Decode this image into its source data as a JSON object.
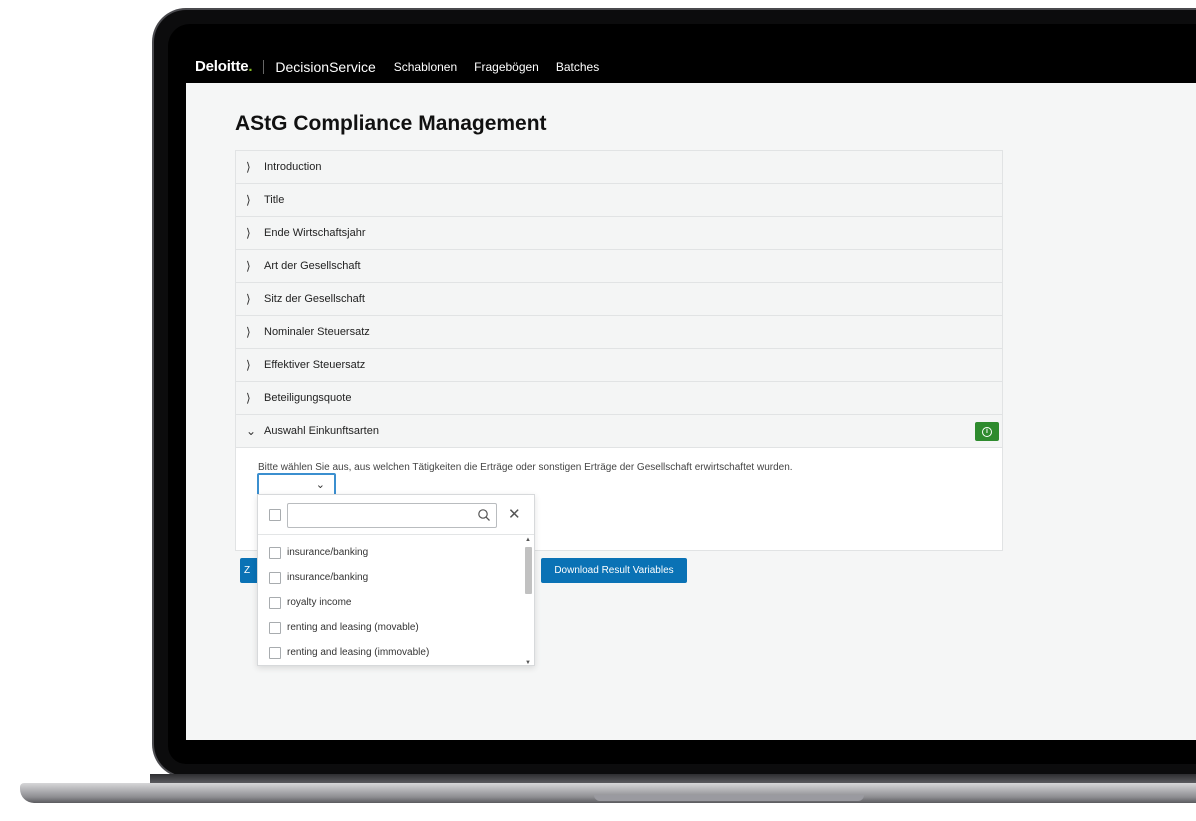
{
  "header": {
    "brand": "Deloitte",
    "brand_dot": ".",
    "app_name": "DecisionService",
    "nav": [
      "Schablonen",
      "Fragebögen",
      "Batches"
    ]
  },
  "page": {
    "title": "AStG Compliance Management"
  },
  "accordion": {
    "items": [
      "Introduction",
      "Title",
      "Ende Wirtschaftsjahr",
      "Art der Gesellschaft",
      "Sitz der Gesellschaft",
      "Nominaler Steuersatz",
      "Effektiver Steuersatz",
      "Beteiligungsquote"
    ],
    "expanded": {
      "label": "Auswahl Einkunftsarten",
      "question": "Bitte wählen Sie aus, aus welchen Tätigkeiten die Erträge oder sonstigen Erträge der Gesellschaft erwirtschaftet wurden."
    }
  },
  "buttons": {
    "left_label": "Z",
    "download_label": "Download Result Variables"
  },
  "dropdown": {
    "search_placeholder": "",
    "items": [
      "insurance/banking",
      "insurance/banking",
      "royalty income",
      "renting and leasing (movable)",
      "renting and leasing (immovable)"
    ]
  },
  "icons": {
    "chevron": "chevron-right-icon",
    "expanded_chevron": "chevron-down-icon",
    "info": "info-icon",
    "search": "search-icon",
    "close": "close-icon"
  },
  "colors": {
    "brand_green": "#86bc25",
    "primary_blue": "#0a72b5",
    "info_green": "#2e8b2e",
    "focus_blue": "#3b8fcf"
  }
}
